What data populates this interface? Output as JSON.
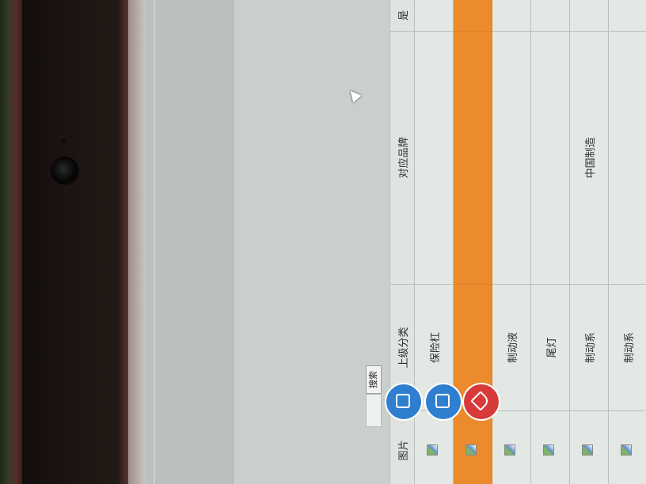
{
  "search": {
    "button_label": "搜索",
    "input_value": ""
  },
  "table": {
    "headers": {
      "picture": "图片",
      "parent_category": "上级分类",
      "brand": "对应品牌",
      "yes": "是"
    },
    "rows": [
      {
        "parent": "保险杠",
        "brand": ""
      },
      {
        "parent": "",
        "brand": ""
      },
      {
        "parent": "制动液",
        "brand": ""
      },
      {
        "parent": "尾灯",
        "brand": ""
      },
      {
        "parent": "制动系",
        "brand": "中国制造"
      },
      {
        "parent": "制动系",
        "brand": ""
      },
      {
        "parent": "",
        "brand": ""
      }
    ],
    "selected_row_index": 1
  },
  "colors": {
    "selected_row": "#ec8a2e",
    "fab_blue": "#2f7fd0",
    "fab_red": "#d63a3a"
  },
  "fabs": [
    "phone-icon",
    "tablet-icon",
    "tag-icon"
  ]
}
